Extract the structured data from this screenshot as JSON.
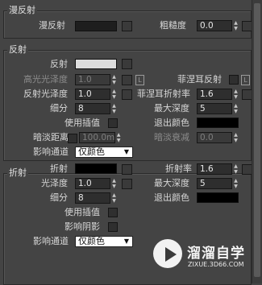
{
  "diffuse_group": {
    "title": "漫反射",
    "diffuse_label": "漫反射",
    "diffuse_color": "#1e1e1e",
    "roughness_label": "粗糙度",
    "roughness_value": "0.0"
  },
  "reflection_group": {
    "title": "反射",
    "reflect_label": "反射",
    "reflect_color": "#dcdcdc",
    "hilight_gloss_label": "高光光泽度",
    "hilight_gloss_value": "1.0",
    "lock_label": "L",
    "fresnel_label": "菲涅耳反射",
    "fresnel_lock_label": "L",
    "refl_gloss_label": "反射光泽度",
    "refl_gloss_value": "1.0",
    "fresnel_ior_label": "菲涅耳折射率",
    "fresnel_ior_value": "1.6",
    "subdivs_label": "细分",
    "subdivs_value": "8",
    "max_depth_label": "最大深度",
    "max_depth_value": "5",
    "use_interp_label": "使用插值",
    "exit_color_label": "退出颜色",
    "exit_color": "#000000",
    "dim_distance_label": "暗淡距离",
    "dim_distance_value": "100.0m",
    "dim_falloff_label": "暗淡衰减",
    "dim_falloff_value": "0.0",
    "affect_channels_label": "影响通道",
    "affect_channels_value": "仅颜色"
  },
  "refraction_group": {
    "title": "折射",
    "refract_label": "折射",
    "refract_color": "#000000",
    "ior_label": "折射率",
    "ior_value": "1.6",
    "gloss_label": "光泽度",
    "gloss_value": "1.0",
    "max_depth_label": "最大深度",
    "max_depth_value": "5",
    "subdivs_label": "细分",
    "subdivs_value": "8",
    "exit_color_label": "退出颜色",
    "exit_color": "#000000",
    "use_interp_label": "使用插值",
    "affect_shadows_label": "影响阴影",
    "affect_channels_label": "影响通道",
    "affect_channels_value": "仅颜色"
  },
  "watermark": {
    "title": "溜溜自学",
    "url": "ZIXUE.3D66.COM"
  }
}
